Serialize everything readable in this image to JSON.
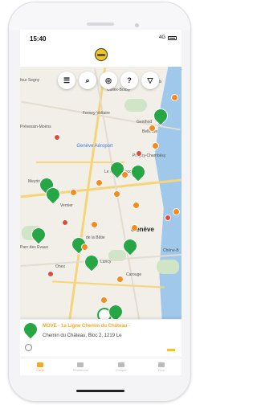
{
  "status": {
    "time": "15:40",
    "network": "4G"
  },
  "toolbar": {
    "list_icon": "☰",
    "search_icon": "⌕",
    "locate_icon": "◎",
    "help_icon": "?",
    "filter_icon": "▽"
  },
  "map": {
    "places": {
      "bour_segny": "four Segny",
      "geneve": "Genève",
      "geneve_aeroport": "Genève Aéroport",
      "vernier": "Vernier",
      "lancy": "Lancy",
      "ferney": "Ferney-Voltaire",
      "prevessin": "Prévessin-Moëns",
      "collex": "Collex-Bossy",
      "bellevue": "Bellevue",
      "genthod": "Genthod",
      "pregny": "Pregny-Chambésy",
      "le_grand_saconnex": "Le Grand-Saconnex",
      "de_la_batie": "de la Bâtie",
      "parc_des_evaux": "Parc des Evaux",
      "onex": "Onex",
      "carouge": "Carouge",
      "chene": "Chêne-B",
      "versoix": "Versoix",
      "meyrin": "Meyrin"
    }
  },
  "card": {
    "title": "MOVE - 1a Ligne Chemin du Château -",
    "address": "Chemin du Château, Bloc 2, 1219 Le"
  },
  "tabs": [
    {
      "label": "Carte"
    },
    {
      "label": "Recherche"
    },
    {
      "label": "Compte"
    },
    {
      "label": "Plus"
    }
  ]
}
